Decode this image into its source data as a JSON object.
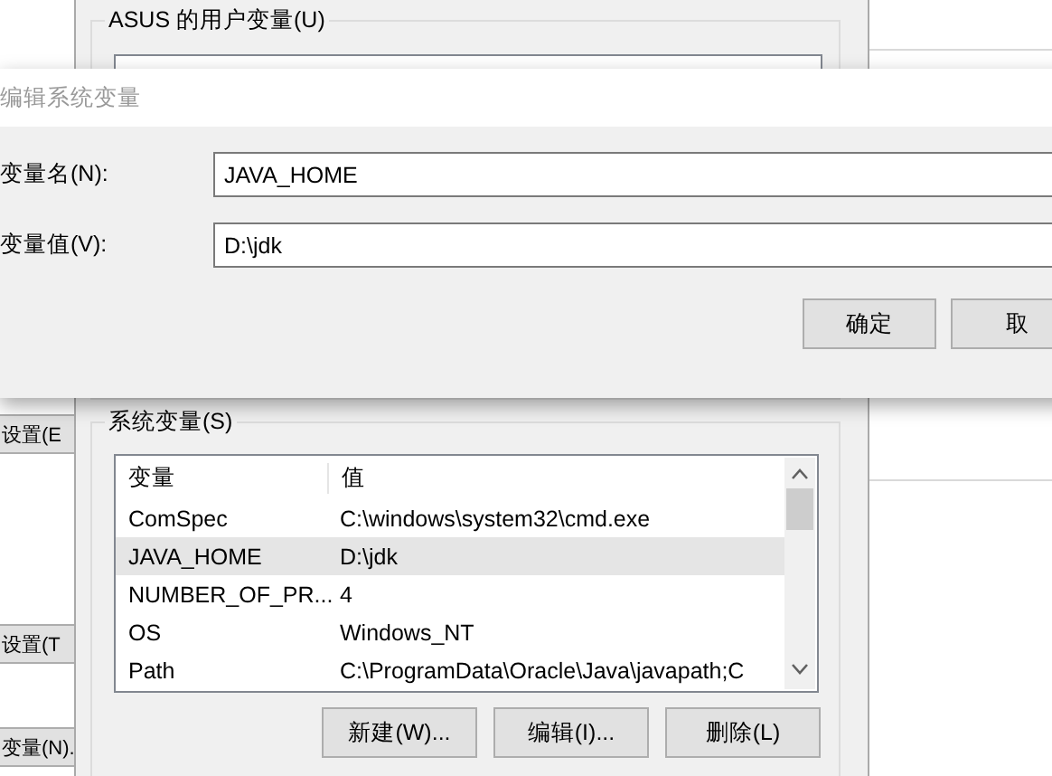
{
  "background_window": {
    "buttons": [
      "设置(E",
      "设置(T",
      "变量(N)."
    ]
  },
  "env_window": {
    "user_group": {
      "title": "ASUS 的用户变量(U)"
    },
    "system_group": {
      "title": "系统变量(S)",
      "columns": [
        "变量",
        "值"
      ],
      "rows": [
        {
          "name": "ComSpec",
          "value": "C:\\windows\\system32\\cmd.exe",
          "selected": false
        },
        {
          "name": "JAVA_HOME",
          "value": "D:\\jdk",
          "selected": true
        },
        {
          "name": "NUMBER_OF_PR...",
          "value": "4",
          "selected": false
        },
        {
          "name": "OS",
          "value": "Windows_NT",
          "selected": false
        },
        {
          "name": "Path",
          "value": "C:\\ProgramData\\Oracle\\Java\\javapath;C",
          "selected": false
        }
      ],
      "buttons": [
        "新建(W)...",
        "编辑(I)...",
        "删除(L)"
      ]
    }
  },
  "dialog": {
    "title": "编辑系统变量",
    "fields": [
      {
        "label": "变量名(N):",
        "value": "JAVA_HOME"
      },
      {
        "label": "变量值(V):",
        "value": "D:\\jdk"
      }
    ],
    "buttons": [
      "确定",
      "取"
    ]
  }
}
